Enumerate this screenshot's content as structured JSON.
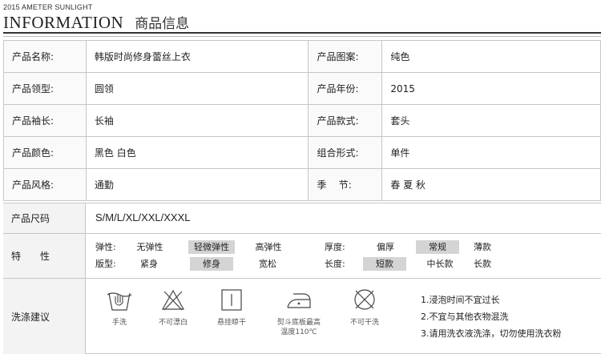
{
  "header": {
    "brand": "2015 AMETER SUNLIGHT",
    "title_en": "INFORMATION",
    "title_cn": "商品信息"
  },
  "spec_rows": [
    {
      "l1": "产品名称:",
      "v1": "韩版时尚修身蕾丝上衣",
      "l2": "产品图案:",
      "v2": "纯色"
    },
    {
      "l1": "产品领型:",
      "v1": "圆领",
      "l2": "产品年份:",
      "v2": "2015"
    },
    {
      "l1": "产品袖长:",
      "v1": "长袖",
      "l2": "产品款式:",
      "v2": "套头"
    },
    {
      "l1": "产品颜色:",
      "v1": "黑色 白色",
      "l2": "组合形式:",
      "v2": "单件"
    },
    {
      "l1": "产品风格:",
      "v1": "通勤",
      "l2": "季    节:",
      "v2": "春 夏 秋"
    }
  ],
  "size": {
    "label": "产品尺码",
    "value": "S/M/L/XL/XXL/XXXL"
  },
  "features": {
    "label": "特　　性",
    "elasticity": {
      "key": "弹性:",
      "options": [
        "无弹性",
        "轻微弹性",
        "高弹性"
      ],
      "selected": "轻微弹性"
    },
    "thickness": {
      "key": "厚度:",
      "options": [
        "偏厚",
        "常规",
        "薄款"
      ],
      "selected": "常规"
    },
    "fit": {
      "key": "版型:",
      "options": [
        "紧身",
        "修身",
        "宽松"
      ],
      "selected": "修身"
    },
    "length": {
      "key": "长度:",
      "options": [
        "短款",
        "中长款",
        "长款"
      ],
      "selected": "短款"
    }
  },
  "wash": {
    "label": "洗涤建议",
    "icons": [
      {
        "icon": "hand-wash-icon",
        "caption": "手洗"
      },
      {
        "icon": "no-bleach-icon",
        "caption": "不可漂白"
      },
      {
        "icon": "hang-dry-icon",
        "caption": "悬挂晾干"
      },
      {
        "icon": "iron-icon",
        "caption_line1": "熨斗底板最高",
        "caption_line2": "温度110℃"
      },
      {
        "icon": "no-dry-clean-icon",
        "caption": "不可干洗"
      }
    ],
    "notes": [
      "1.浸泡时间不宜过长",
      "2.不宜与其他衣物混洗",
      "3.请用洗衣液洗涤，切勿使用洗衣粉"
    ]
  }
}
